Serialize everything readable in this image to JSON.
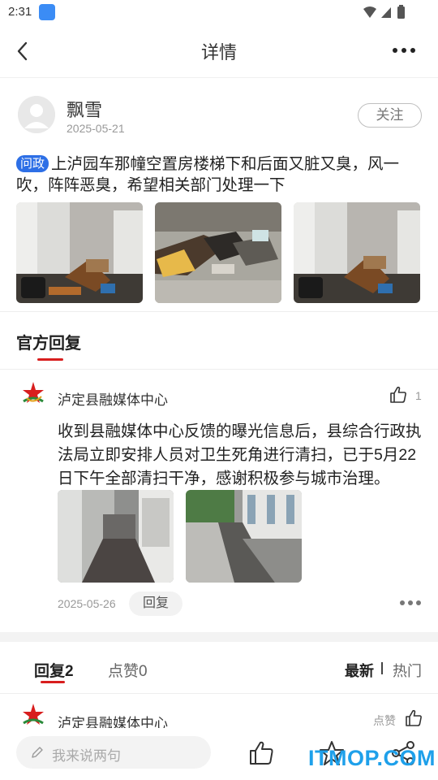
{
  "status_bar": {
    "time": "2:31"
  },
  "header": {
    "title": "详情"
  },
  "post": {
    "username": "飘雪",
    "date": "2025-05-21",
    "follow_label": "关注",
    "tag": "问政",
    "text": "上泸园车那幢空置房楼梯下和后面又脏又臭，风一吹，阵阵恶臭，希望相关部门处理一下"
  },
  "official_reply": {
    "section_title": "官方回复",
    "org_name": "泸定县融媒体中心",
    "like_count": "1",
    "text": "收到县融媒体中心反馈的曝光信息后，县综合行政执法局立即安排人员对卫生死角进行清扫，已于5月22日下午全部清扫干净，感谢积极参与城市治理。",
    "date": "2025-05-26",
    "reply_label": "回复"
  },
  "comments_tabs": {
    "replies_tab": "回复2",
    "likes_tab": "点赞0",
    "sort_latest": "最新",
    "sort_hot": "热门"
  },
  "comment": {
    "org_name": "泸定县融媒体中心",
    "like_label": "点赞"
  },
  "bottom_bar": {
    "placeholder": "我来说两句",
    "watermark": "ITMOP.COM"
  },
  "colors": {
    "accent_red": "#d81e1e",
    "tag_blue": "#2d6fe6",
    "watermark_blue": "#1ea0ea"
  }
}
